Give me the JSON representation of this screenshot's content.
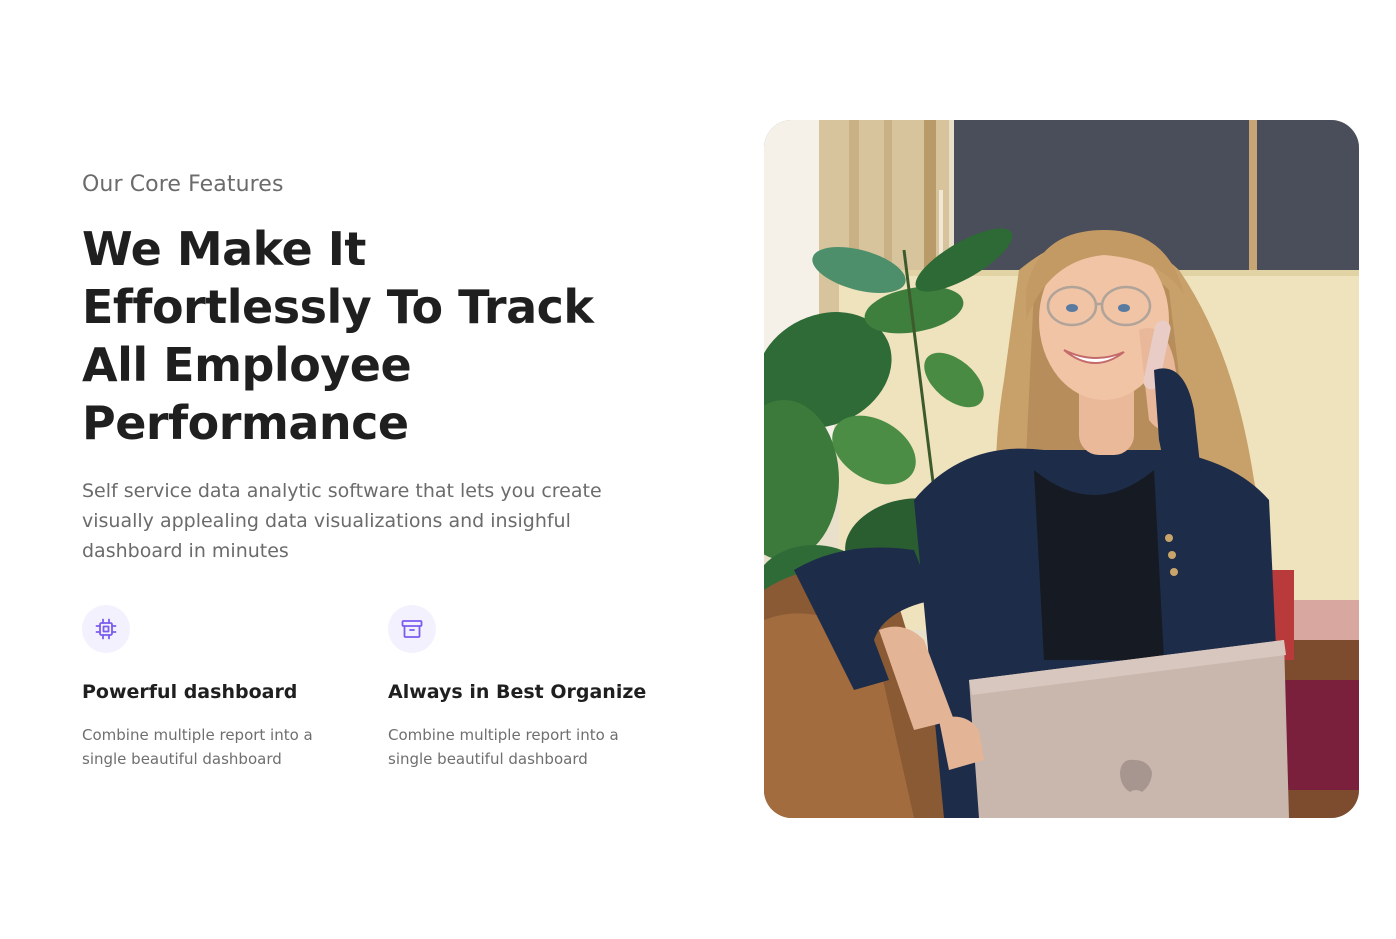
{
  "section": {
    "eyebrow": "Our Core Features",
    "headline_lines": [
      "We Make It",
      "Effortlessly To Track",
      "All Employee",
      "Performance"
    ],
    "description": "Self service data analytic software that lets you create visually applealing data visualizations and insighful dashboard in minutes"
  },
  "features": [
    {
      "icon": "chip-icon",
      "title": "Powerful dashboard",
      "description": "Combine multiple report into a single beautiful dashboard"
    },
    {
      "icon": "archive-box-icon",
      "title": "Always in Best Organize",
      "description": "Combine multiple report into a single beautiful dashboard"
    }
  ],
  "colors": {
    "accent": "#7b5cf0",
    "icon_bg": "#f4f1fe",
    "heading": "#1f1f1f",
    "muted": "#6b6b6b"
  },
  "image": {
    "subject": "woman-on-phone-with-laptop-photo"
  }
}
